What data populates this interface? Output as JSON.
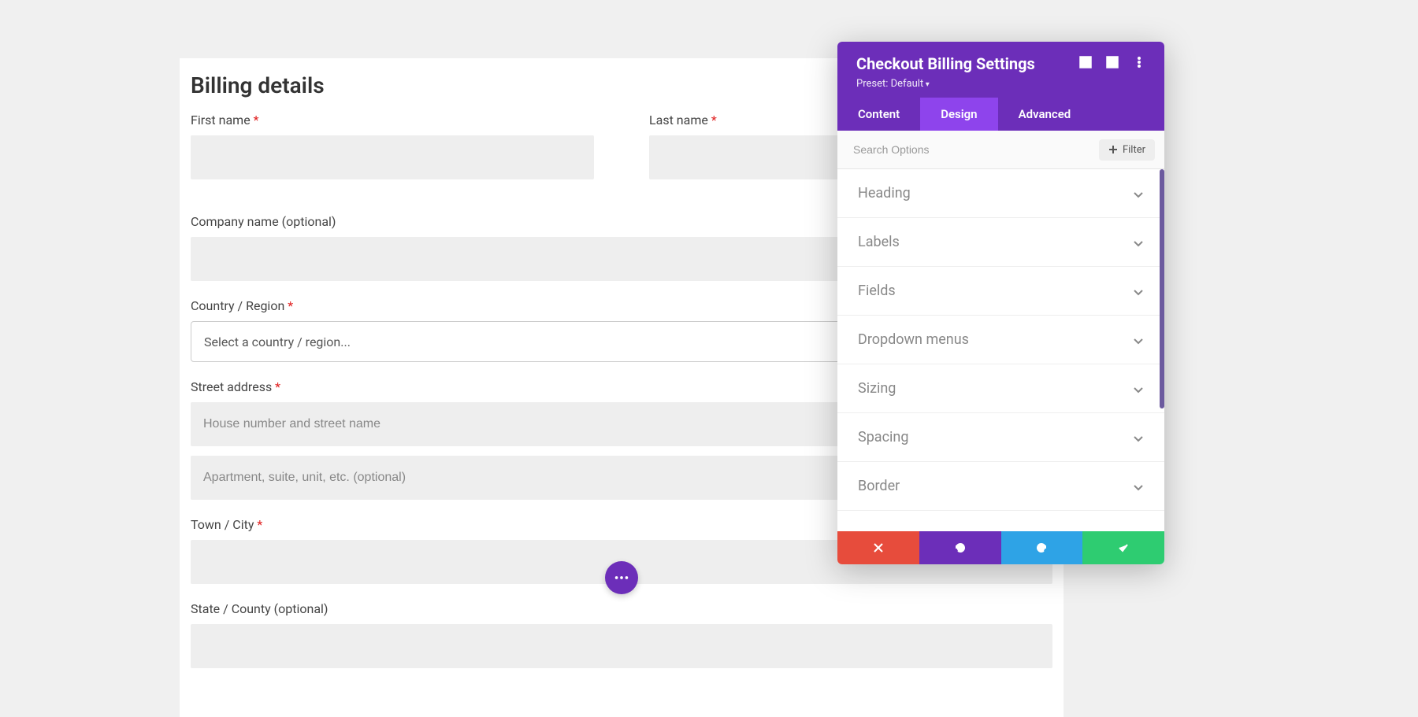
{
  "form": {
    "title": "Billing details",
    "first_name": {
      "label": "First name",
      "required": true,
      "value": ""
    },
    "last_name": {
      "label": "Last name",
      "required": true,
      "value": ""
    },
    "company": {
      "label": "Company name (optional)",
      "required": false,
      "value": ""
    },
    "country": {
      "label": "Country / Region",
      "required": true,
      "placeholder": "Select a country / region..."
    },
    "street": {
      "label": "Street address",
      "required": true,
      "line1_placeholder": "House number and street name",
      "line2_placeholder": "Apartment, suite, unit, etc. (optional)"
    },
    "city": {
      "label": "Town / City",
      "required": true,
      "value": ""
    },
    "state": {
      "label": "State / County (optional)",
      "required": false,
      "value": ""
    }
  },
  "panel": {
    "title": "Checkout Billing Settings",
    "preset": "Preset: Default",
    "tabs": {
      "content": "Content",
      "design": "Design",
      "advanced": "Advanced"
    },
    "search_placeholder": "Search Options",
    "filter_label": "Filter",
    "sections": [
      {
        "label": "Heading"
      },
      {
        "label": "Labels"
      },
      {
        "label": "Fields"
      },
      {
        "label": "Dropdown menus"
      },
      {
        "label": "Sizing"
      },
      {
        "label": "Spacing"
      },
      {
        "label": "Border"
      }
    ]
  },
  "colors": {
    "purple": "#6c2eb9",
    "purple_light": "#8e44ec",
    "red": "#e74c3c",
    "blue": "#2ea3e6",
    "green": "#2ecc71"
  }
}
